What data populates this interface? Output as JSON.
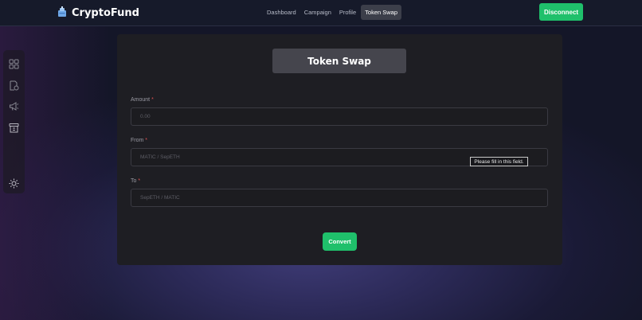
{
  "header": {
    "brand": "CryptoFund",
    "nav": [
      {
        "label": "Dashboard",
        "active": false
      },
      {
        "label": "Campaign",
        "active": false
      },
      {
        "label": "Profile",
        "active": false
      },
      {
        "label": "Token Swap",
        "active": true
      }
    ],
    "disconnect_label": "Disconnect"
  },
  "sidebar": {
    "icons": [
      "dashboard-icon",
      "create-campaign-icon",
      "megaphone-icon",
      "swap-icon",
      "theme-sun-icon"
    ]
  },
  "form": {
    "title": "Token Swap",
    "amount": {
      "label": "Amount",
      "required_mark": "*",
      "placeholder": "0.00",
      "value": ""
    },
    "from": {
      "label": "From",
      "required_mark": "*",
      "placeholder": "MATIC / SepETH",
      "value": ""
    },
    "to": {
      "label": "To",
      "required_mark": "*",
      "placeholder": "SepETH / MATIC",
      "value": ""
    },
    "validation_tooltip": "Please fill in this field.",
    "submit_label": "Convert"
  },
  "colors": {
    "accent_green": "#1fc06b",
    "panel_bg": "#1e1e23",
    "nav_bg": "#161a2a",
    "required_red": "#e05252"
  }
}
